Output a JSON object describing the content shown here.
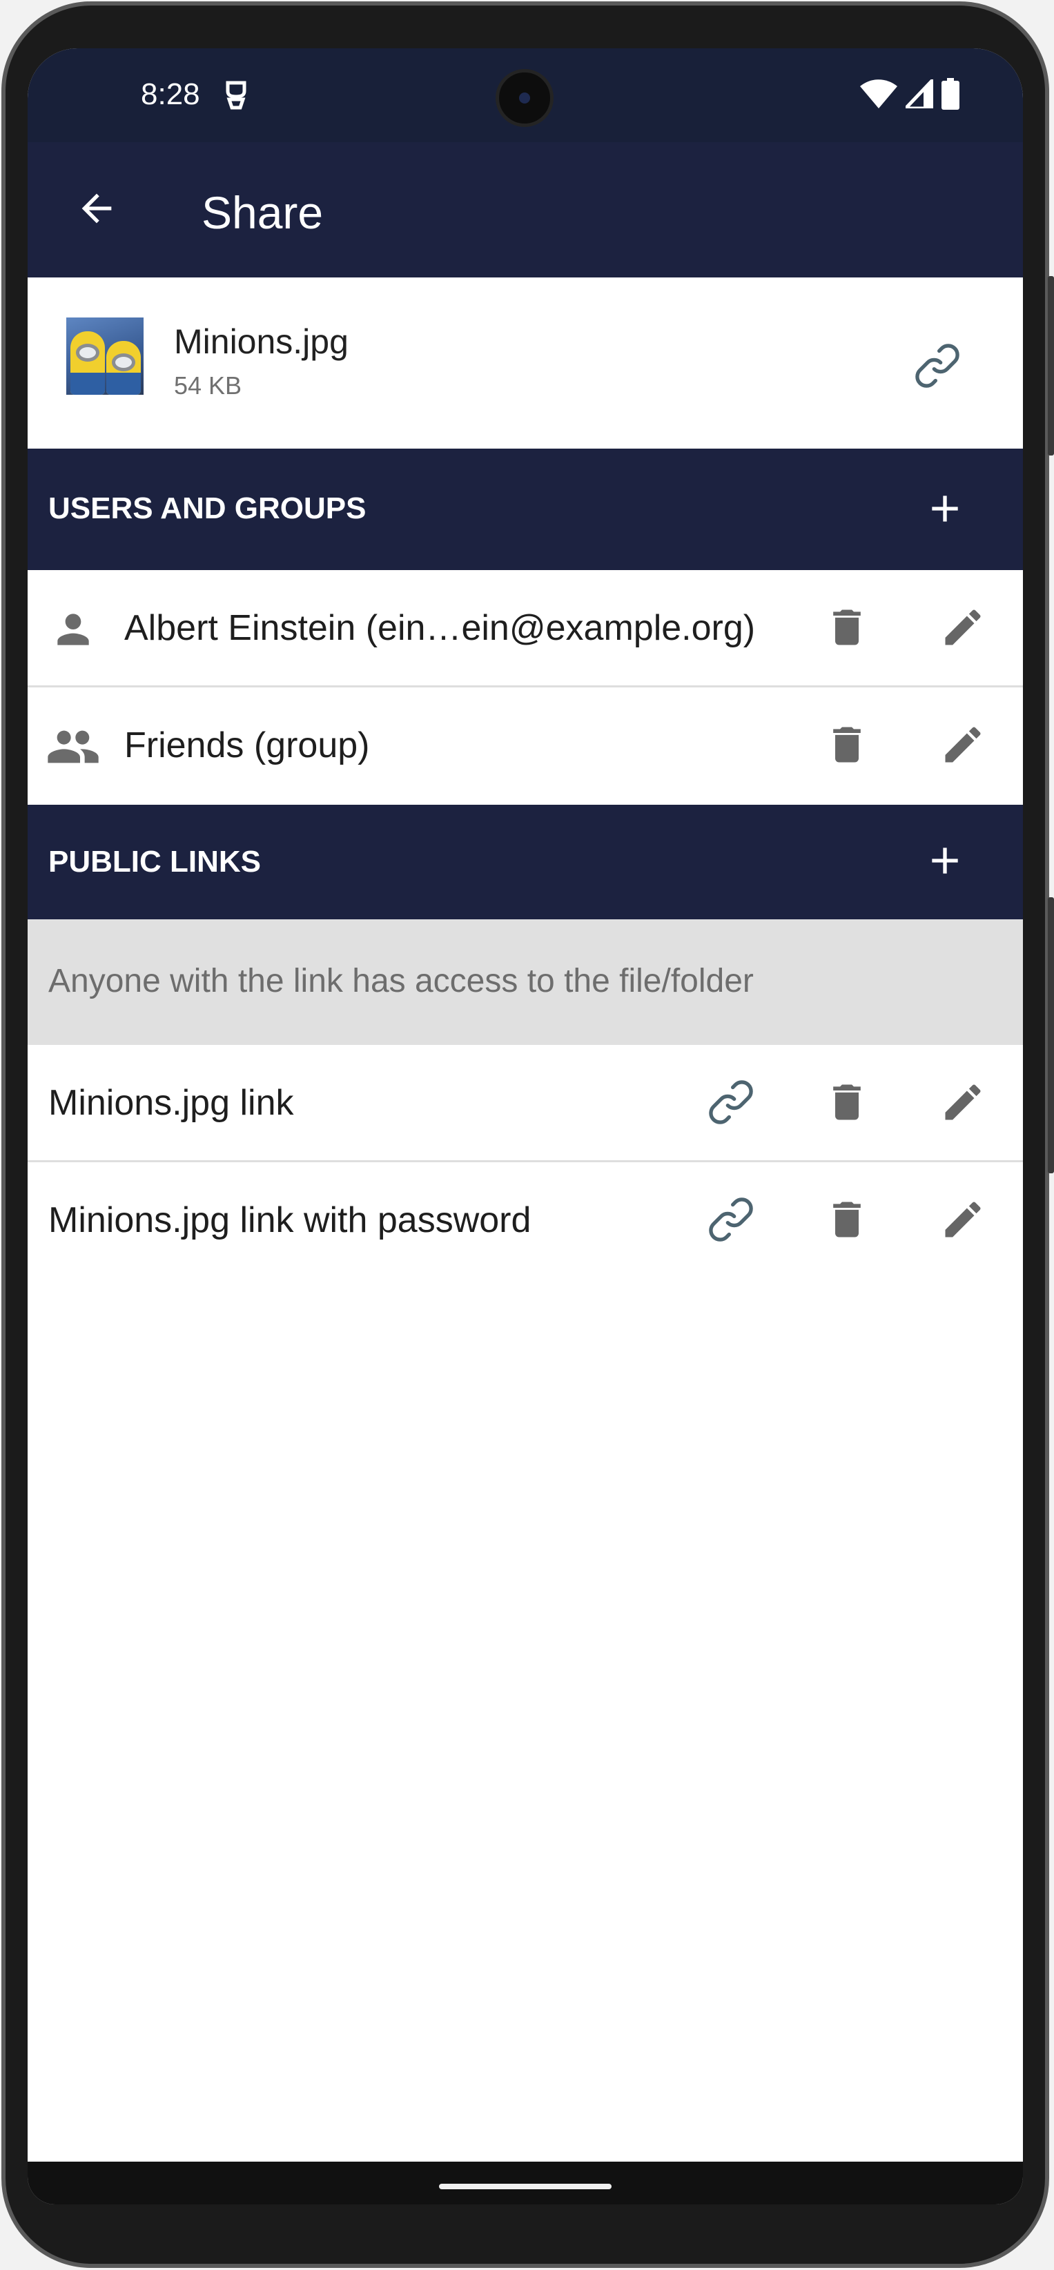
{
  "status_bar": {
    "time": "8:28"
  },
  "app_bar": {
    "title": "Share"
  },
  "file": {
    "name": "Minions.jpg",
    "size": "54 KB"
  },
  "users_groups": {
    "title": "USERS AND GROUPS",
    "items": [
      {
        "label": "Albert Einstein (ein…ein@example.org)",
        "icon": "person-icon"
      },
      {
        "label": "Friends (group)",
        "icon": "group-icon"
      }
    ]
  },
  "public_links": {
    "title": "PUBLIC LINKS",
    "info": "Anyone with the link has access to the file/folder",
    "items": [
      {
        "label": "Minions.jpg link"
      },
      {
        "label": "Minions.jpg link with password"
      }
    ]
  },
  "colors": {
    "app_bar": "#1c2240",
    "status_bar": "#182039",
    "icon_gray": "#666666",
    "link_icon": "#4d6470",
    "info_bg": "#e0e0e0"
  }
}
